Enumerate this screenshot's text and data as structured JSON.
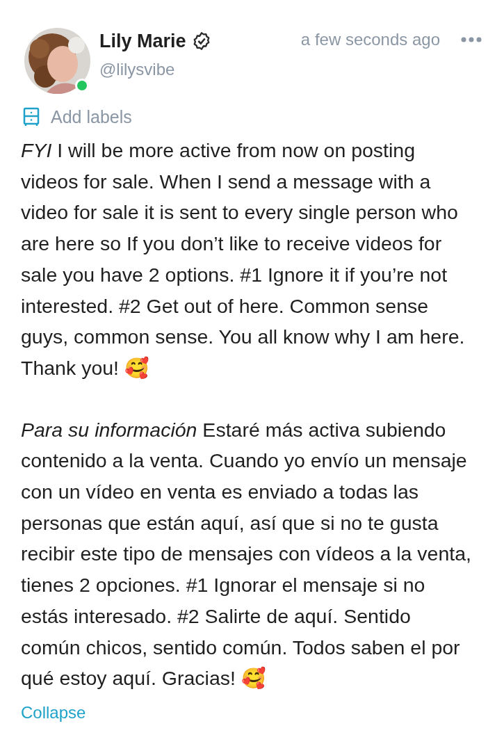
{
  "post": {
    "author": {
      "name": "Lily Marie",
      "verified": true,
      "handle": "@lilysvibe",
      "online": true
    },
    "time": "a few seconds ago",
    "labels_action": "Add labels",
    "paragraphs": [
      {
        "text": "*FYI* I will be more active from now on posting videos for sale. When I send a message with a video for sale it is sent to every single person who are here so If you don’t like to receive videos for sale you have 2 options. #1 Ignore it if you’re not interested. #2 Get out of here. Common sense guys, common sense. You all know why I am here. Thank you! 🥰"
      },
      {
        "text": "*Para su información* Estaré más activa subiendo contenido a la venta. Cuando yo envío un mensaje con un vídeo en venta es enviado a todas las personas que están aquí, así que si no te gusta recibir este tipo de mensajes con vídeos a la venta, tienes 2 opciones. #1 Ignorar el mensaje si no estás interesado. #2 Salirte de aquí. Sentido común chicos, sentido común. Todos saben el por qué estoy aquí. Gracias! 🥰"
      }
    ],
    "collapse": "Collapse"
  }
}
